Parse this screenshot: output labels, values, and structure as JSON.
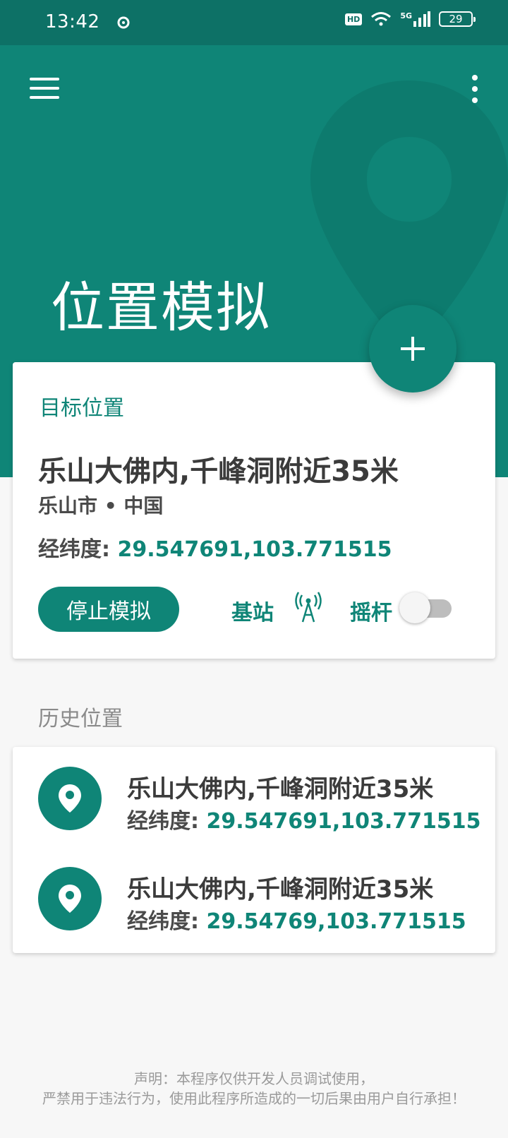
{
  "status_bar": {
    "time": "13:42",
    "hd": "HD",
    "network": "5G",
    "battery": "29"
  },
  "header": {
    "title": "位置模拟"
  },
  "target": {
    "label": "目标位置",
    "name": "乐山大佛内,千峰洞附近35米",
    "region": "乐山市 • 中国",
    "coord_label": "经纬度:",
    "coord_value": "29.547691,103.771515",
    "stop_button": "停止模拟",
    "base_station": "基站",
    "joystick": "摇杆",
    "joystick_enabled": false
  },
  "history": {
    "title": "历史位置",
    "items": [
      {
        "name": "乐山大佛内,千峰洞附近35米",
        "coord_label": "经纬度:",
        "coord_value": "29.547691,103.771515"
      },
      {
        "name": "乐山大佛内,千峰洞附近35米",
        "coord_label": "经纬度:",
        "coord_value": "29.54769,103.771515"
      }
    ]
  },
  "disclaimer": {
    "line1": "声明：本程序仅供开发人员调试使用，",
    "line2": "严禁用于违法行为，使用此程序所造成的一切后果由用户自行承担！"
  },
  "colors": {
    "primary": "#0f8577",
    "status_bar": "#0d7166",
    "text_dark": "#3b3b3b",
    "background": "#f7f7f7"
  },
  "icons": {
    "menu": "hamburger-icon",
    "more": "more-vertical-icon",
    "add": "plus-icon",
    "base_station": "antenna-icon",
    "history": "location-pin-icon"
  }
}
